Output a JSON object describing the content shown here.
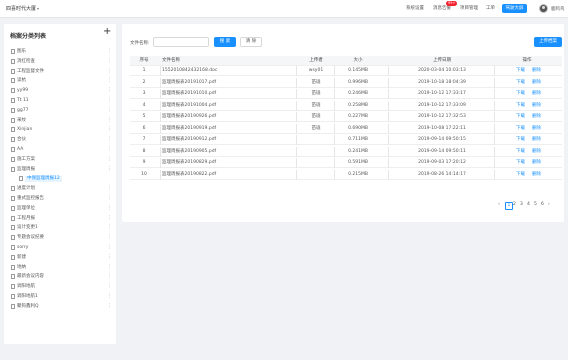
{
  "header": {
    "brand": "四喜时代大厦",
    "nav": [
      "系统设置",
      "消息告警",
      "项目管理",
      "工单"
    ],
    "badge": "99+",
    "bigscreen_label": "驾驶大屏",
    "username": "鹿鸣鸟"
  },
  "sidebar": {
    "title": "档案分类列表",
    "add_icon": "+",
    "more_icon": "⋮",
    "items": [
      {
        "label": "图乐"
      },
      {
        "label": "消红检查"
      },
      {
        "label": "工程监督文件"
      },
      {
        "label": "读杭"
      },
      {
        "label": "yy99"
      },
      {
        "label": "Tt 11"
      },
      {
        "label": "gg77"
      },
      {
        "label": "采纹"
      },
      {
        "label": "Xinjian"
      },
      {
        "label": "合伙"
      },
      {
        "label": "AA"
      },
      {
        "label": "施工方案"
      },
      {
        "label": "监理周报"
      },
      {
        "label": "中保监理周报12"
      },
      {
        "label": "进度计划"
      },
      {
        "label": "重式监控报告"
      },
      {
        "label": "监理单位"
      },
      {
        "label": "工程月报"
      },
      {
        "label": "设计变更1"
      },
      {
        "label": "专题会议纪要"
      },
      {
        "label": "sorry"
      },
      {
        "label": "新建"
      },
      {
        "label": "地纳"
      },
      {
        "label": "最新会议内容"
      },
      {
        "label": "调阳地航"
      },
      {
        "label": "调阳地航1"
      },
      {
        "label": "聚钩鑫利Q"
      }
    ]
  },
  "toolbar": {
    "filename_label": "文件名称:",
    "filename_value": "",
    "search_label": "搜 索",
    "clear_label": "清 除",
    "upload_label": "上传档案"
  },
  "table": {
    "headers": [
      "序号",
      "文件名称",
      "上传者",
      "大小",
      "上传日期",
      "操作"
    ],
    "download_label": "下载",
    "delete_label": "删除",
    "rows": [
      {
        "no": "1",
        "name": "1552010842432168.doc",
        "uploader": "wsy01",
        "size": "0.145MB",
        "date": "2020-03-04 10:03:13"
      },
      {
        "no": "2",
        "name": "监理周报表20191017.pdf",
        "uploader": "苗珑",
        "size": "0.996MB",
        "date": "2019-10-18 18:04:39"
      },
      {
        "no": "3",
        "name": "监理周报表20191010.pdf",
        "uploader": "苗珑",
        "size": "0.246MB",
        "date": "2019-10-12 17:33:17"
      },
      {
        "no": "4",
        "name": "监理周报表20191004.pdf",
        "uploader": "苗珑",
        "size": "0.258MB",
        "date": "2019-10-12 17:33:09"
      },
      {
        "no": "5",
        "name": "监理周报表20190926.pdf",
        "uploader": "苗珑",
        "size": "0.227MB",
        "date": "2019-10-12 17:32:53"
      },
      {
        "no": "6",
        "name": "监理周报表20190919.pdf",
        "uploader": "苗珑",
        "size": "0.690MB",
        "date": "2019-10-08 17:22:11"
      },
      {
        "no": "7",
        "name": "监理周报表20190912.pdf",
        "uploader": "",
        "size": "0.711MB",
        "date": "2019-09-14 09:50:15"
      },
      {
        "no": "8",
        "name": "监理周报表20190905.pdf",
        "uploader": "",
        "size": "0.241MB",
        "date": "2019-09-14 09:50:11"
      },
      {
        "no": "9",
        "name": "监理周报表20190829.pdf",
        "uploader": "",
        "size": "0.591MB",
        "date": "2019-09-03 17:20:12"
      },
      {
        "no": "10",
        "name": "监理周报表20190822.pdf",
        "uploader": "",
        "size": "0.215MB",
        "date": "2019-08-26 14:14:17"
      }
    ]
  },
  "pagination": {
    "prev": "‹",
    "pages": [
      "1",
      "2",
      "3",
      "4",
      "5",
      "6"
    ],
    "current": "1",
    "next": "›"
  }
}
